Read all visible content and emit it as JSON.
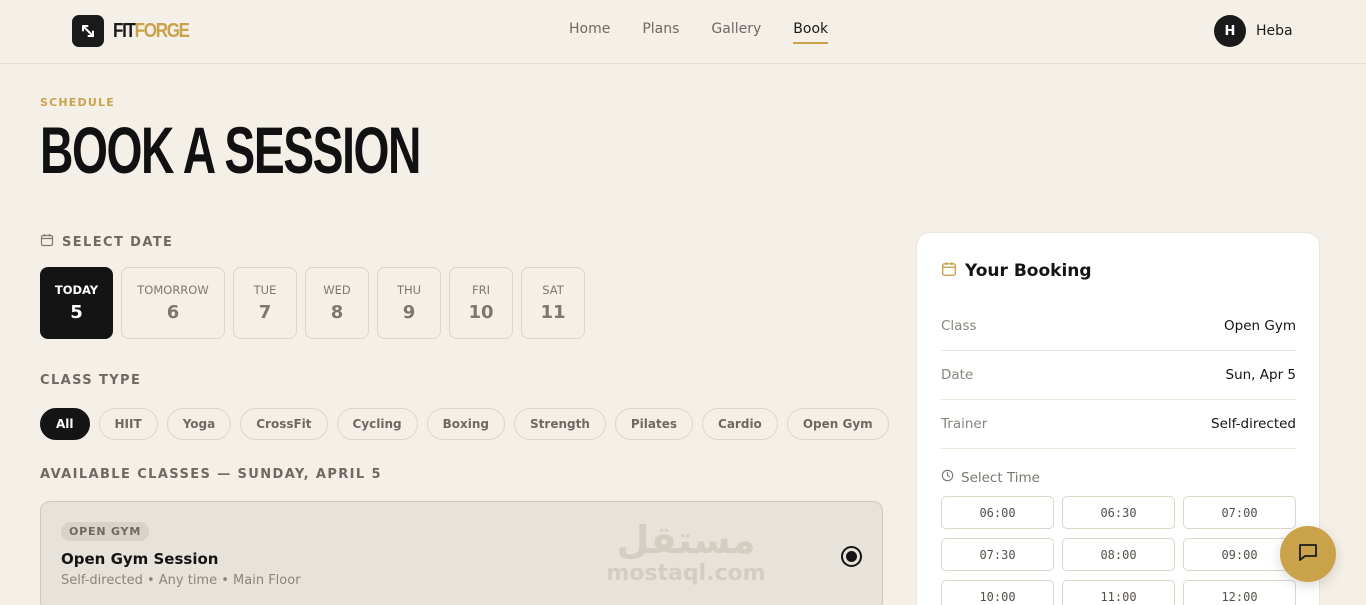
{
  "header": {
    "logo_part1": "FIT",
    "logo_part2": "FORGE",
    "nav": [
      "Home",
      "Plans",
      "Gallery",
      "Book"
    ],
    "active_nav": "Book",
    "user_initial": "H",
    "user_name": "Heba"
  },
  "page": {
    "eyebrow": "SCHEDULE",
    "title": "BOOK A SESSION"
  },
  "date_section": {
    "label": "SELECT DATE",
    "dates": [
      {
        "day": "TODAY",
        "num": "5",
        "selected": true
      },
      {
        "day": "TOMORROW",
        "num": "6",
        "selected": false
      },
      {
        "day": "TUE",
        "num": "7",
        "selected": false
      },
      {
        "day": "WED",
        "num": "8",
        "selected": false
      },
      {
        "day": "THU",
        "num": "9",
        "selected": false
      },
      {
        "day": "FRI",
        "num": "10",
        "selected": false
      },
      {
        "day": "SAT",
        "num": "11",
        "selected": false
      }
    ]
  },
  "class_type": {
    "label": "CLASS TYPE",
    "chips": [
      "All",
      "HIIT",
      "Yoga",
      "CrossFit",
      "Cycling",
      "Boxing",
      "Strength",
      "Pilates",
      "Cardio",
      "Open Gym"
    ],
    "selected": "All"
  },
  "available": {
    "label": "AVAILABLE CLASSES — SUNDAY, APRIL 5",
    "classes": [
      {
        "tag": "OPEN GYM",
        "name": "Open Gym Session",
        "meta": "Self-directed • Any time • Main Floor",
        "selected": true
      }
    ]
  },
  "watermark": {
    "arabic": "مستقل",
    "latin": "mostaql.com"
  },
  "booking": {
    "title": "Your Booking",
    "rows": [
      {
        "label": "Class",
        "value": "Open Gym"
      },
      {
        "label": "Date",
        "value": "Sun, Apr 5"
      },
      {
        "label": "Trainer",
        "value": "Self-directed"
      }
    ],
    "time_label": "Select Time",
    "slots": [
      "06:00",
      "06:30",
      "07:00",
      "07:30",
      "08:00",
      "09:00",
      "10:00",
      "11:00",
      "12:00"
    ]
  },
  "colors": {
    "accent": "#c9a24a",
    "dark": "#141414",
    "background": "#f4f0e8"
  },
  "icons": [
    "expand-arrows-icon",
    "calendar-icon",
    "clock-icon",
    "chat-icon",
    "radio-selected-icon"
  ]
}
